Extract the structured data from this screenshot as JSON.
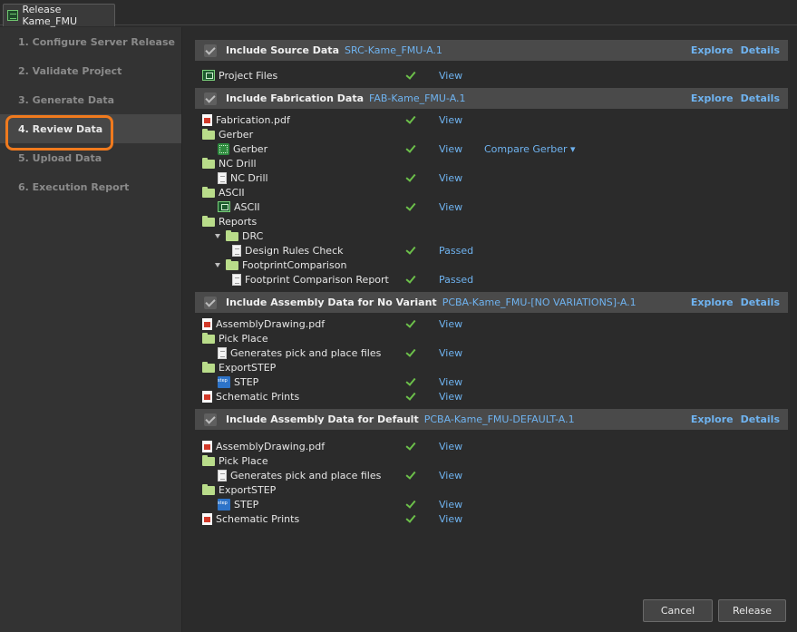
{
  "window": {
    "tab_title": "Release Kame_FMU"
  },
  "steps": [
    "1. Configure Server Release",
    "2. Validate Project",
    "3. Generate Data",
    "4. Review Data",
    "5. Upload Data",
    "6. Execution Report"
  ],
  "active_step_index": 3,
  "common": {
    "explore": "Explore",
    "details": "Details"
  },
  "sections": [
    {
      "title": "Include Source Data",
      "id": "SRC-Kame_FMU-A.1",
      "rows": [
        {
          "name": "Project Files",
          "icon": "pcb-project-icon",
          "indent": 0,
          "check": true,
          "action": "View"
        }
      ]
    },
    {
      "title": "Include Fabrication Data",
      "id": "FAB-Kame_FMU-A.1",
      "rows": [
        {
          "name": "Fabrication.pdf",
          "icon": "pdf-icon",
          "indent": 0,
          "check": true,
          "action": "View"
        },
        {
          "name": "Gerber",
          "icon": "folder-icon",
          "indent": 0,
          "check": false,
          "action": ""
        },
        {
          "name": "Gerber",
          "icon": "gerber-icon",
          "indent": 1,
          "check": true,
          "action": "View",
          "extra": "Compare Gerber ▾"
        },
        {
          "name": "NC Drill",
          "icon": "folder-icon",
          "indent": 0,
          "check": false,
          "action": ""
        },
        {
          "name": "NC Drill",
          "icon": "document-icon",
          "indent": 1,
          "check": true,
          "action": "View"
        },
        {
          "name": "ASCII",
          "icon": "folder-icon",
          "indent": 0,
          "check": false,
          "action": ""
        },
        {
          "name": "ASCII",
          "icon": "pcb-icon",
          "indent": 1,
          "check": true,
          "action": "View"
        },
        {
          "name": "Reports",
          "icon": "folder-icon",
          "indent": 0,
          "check": false,
          "action": ""
        },
        {
          "name": "DRC",
          "icon": "folder-icon",
          "indent": 1,
          "expander": true,
          "check": false,
          "action": ""
        },
        {
          "name": "Design Rules Check",
          "icon": "document-icon",
          "indent": 2,
          "check": true,
          "action": "Passed"
        },
        {
          "name": "FootprintComparison",
          "icon": "folder-icon",
          "indent": 1,
          "expander": true,
          "check": false,
          "action": ""
        },
        {
          "name": "Footprint Comparison Report",
          "icon": "document-icon",
          "indent": 2,
          "check": true,
          "action": "Passed"
        }
      ]
    },
    {
      "title": "Include Assembly Data for No Variant",
      "id": "PCBA-Kame_FMU-[NO VARIATIONS]-A.1",
      "rows": [
        {
          "name": "AssemblyDrawing.pdf",
          "icon": "pdf-icon",
          "indent": 0,
          "check": true,
          "action": "View"
        },
        {
          "name": "Pick Place",
          "icon": "folder-icon",
          "indent": 0,
          "check": false,
          "action": ""
        },
        {
          "name": "Generates pick and place files",
          "icon": "document-icon",
          "indent": 1,
          "check": true,
          "action": "View"
        },
        {
          "name": "ExportSTEP",
          "icon": "folder-icon",
          "indent": 0,
          "check": false,
          "action": ""
        },
        {
          "name": "STEP",
          "icon": "step-icon",
          "indent": 1,
          "check": true,
          "action": "View"
        },
        {
          "name": "Schematic Prints",
          "icon": "pdf-icon",
          "indent": 0,
          "check": true,
          "action": "View"
        }
      ]
    },
    {
      "title": "Include Assembly Data for Default",
      "id": "PCBA-Kame_FMU-DEFAULT-A.1",
      "rows": [
        {
          "name": "AssemblyDrawing.pdf",
          "icon": "pdf-icon",
          "indent": 0,
          "check": true,
          "action": "View"
        },
        {
          "name": "Pick Place",
          "icon": "folder-icon",
          "indent": 0,
          "check": false,
          "action": ""
        },
        {
          "name": "Generates pick and place files",
          "icon": "document-icon",
          "indent": 1,
          "check": true,
          "action": "View"
        },
        {
          "name": "ExportSTEP",
          "icon": "folder-icon",
          "indent": 0,
          "check": false,
          "action": ""
        },
        {
          "name": "STEP",
          "icon": "step-icon",
          "indent": 1,
          "check": true,
          "action": "View"
        },
        {
          "name": "Schematic Prints",
          "icon": "pdf-icon",
          "indent": 0,
          "check": true,
          "action": "View"
        }
      ]
    }
  ],
  "footer": {
    "cancel": "Cancel",
    "release": "Release"
  }
}
